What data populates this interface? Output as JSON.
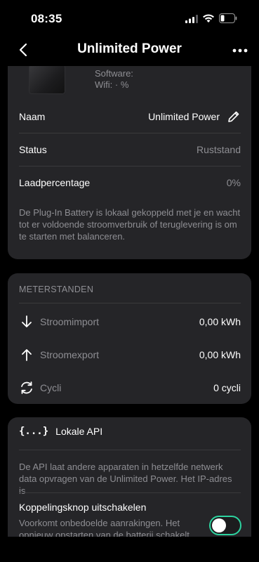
{
  "status_bar": {
    "time": "08:35"
  },
  "nav": {
    "title": "Unlimited Power"
  },
  "device": {
    "software_label": "Software:",
    "wifi_label": "Wifi:  · %"
  },
  "info": {
    "name_label": "Naam",
    "name_value": "Unlimited Power",
    "status_label": "Status",
    "status_value": "Ruststand",
    "charge_label": "Laadpercentage",
    "charge_value": "0%",
    "description": "De Plug-In Battery is lokaal gekoppeld met je  en wacht tot er voldoende stroomverbruik of teruglevering is om te starten met balanceren."
  },
  "meters": {
    "header": "METERSTANDEN",
    "items": [
      {
        "label": "Stroomimport",
        "value": "0,00 kWh",
        "icon": "arrow-down-icon"
      },
      {
        "label": "Stroomexport",
        "value": "0,00 kWh",
        "icon": "arrow-up-icon"
      },
      {
        "label": "Cycli",
        "value": "0 cycli",
        "icon": "cycle-icon"
      }
    ]
  },
  "api": {
    "icon_text": "{...}",
    "label": "Lokale API",
    "description": "De API laat andere apparaten in hetzelfde netwerk data opvragen van de Unlimited Power. Het IP-adres is"
  },
  "lock": {
    "label": "Koppelingsknop uitschakelen",
    "description": "Voorkomt onbedoelde aanrakingen. Het opnieuw opstarten van de batterij schakelt",
    "enabled": false
  },
  "colors": {
    "accent": "#2dd4a0",
    "card": "#252528",
    "muted": "#8e8e93"
  }
}
